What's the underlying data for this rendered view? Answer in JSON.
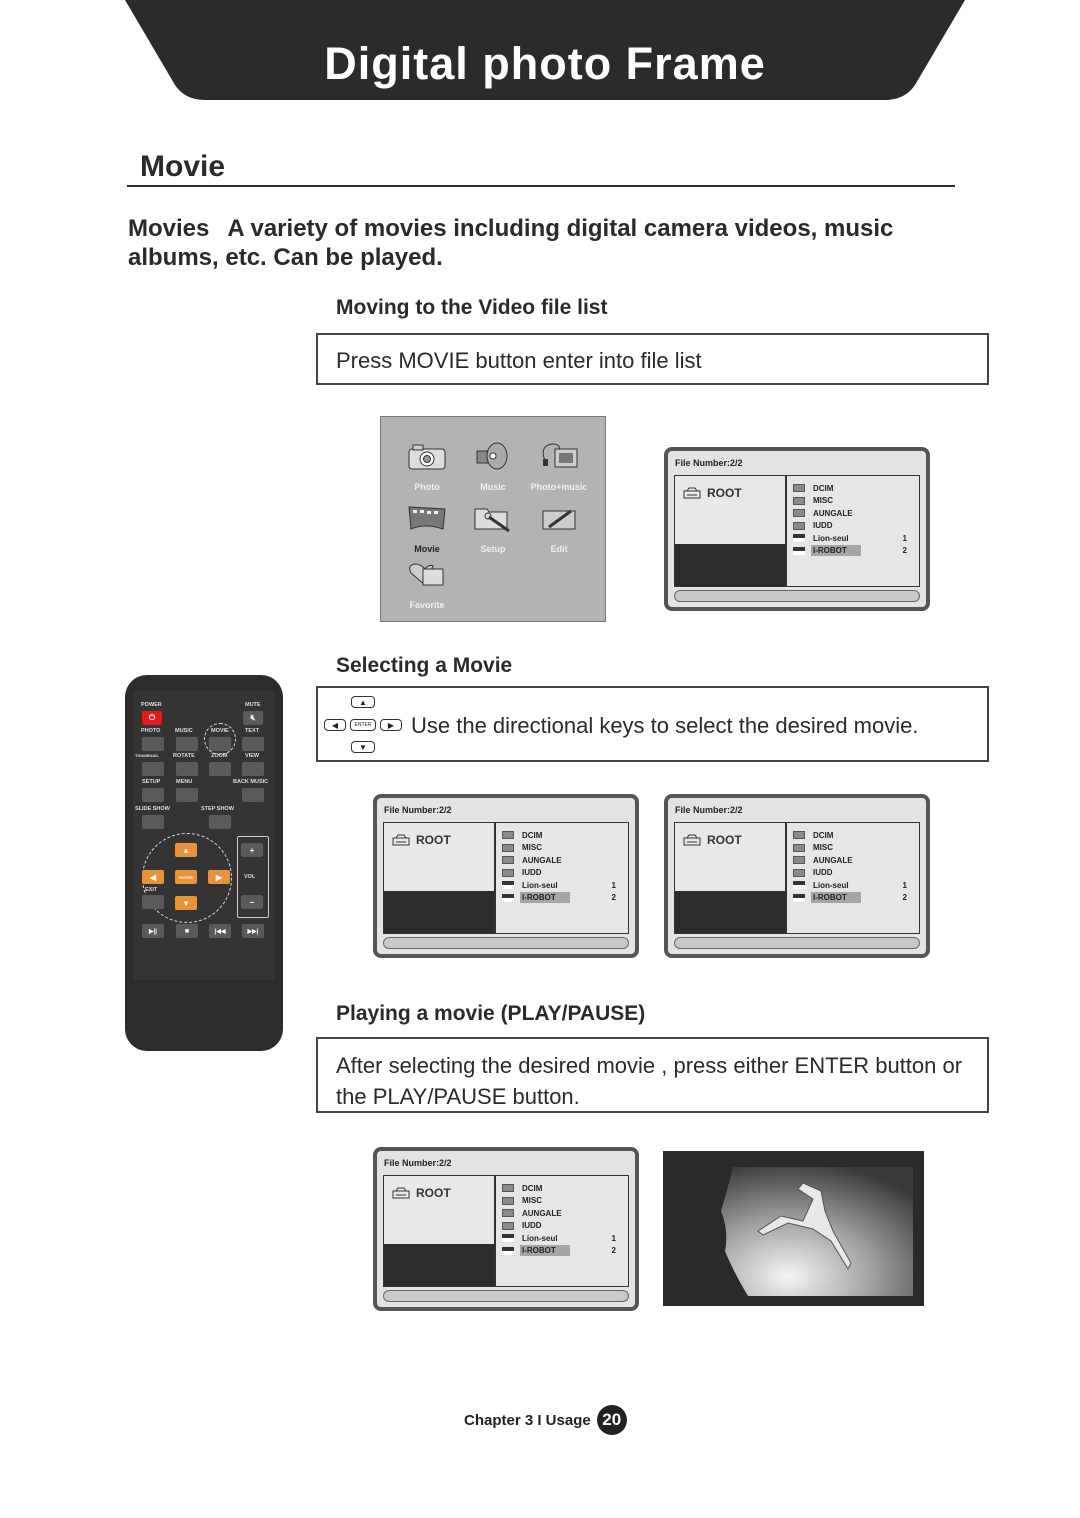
{
  "header": {
    "title": "Digital photo Frame"
  },
  "section": {
    "title": "Movie",
    "intro_lead": "Movies",
    "intro_text": "A variety of movies including digital camera videos, music albums, etc. Can be played."
  },
  "steps": [
    {
      "heading": "Moving to the Video file list",
      "instruction": "Press MOVIE button enter into  file list"
    },
    {
      "heading": "Selecting a Movie",
      "instruction": "Use the directional keys to select the desired movie."
    },
    {
      "heading": "Playing a movie (PLAY/PAUSE)",
      "instruction": "After selecting the desired movie , press either ENTER button or the PLAY/PAUSE button."
    }
  ],
  "main_menu": {
    "items": [
      {
        "label": "Photo",
        "icon": "camera-icon",
        "active": false
      },
      {
        "label": "Music",
        "icon": "speaker-icon",
        "active": false
      },
      {
        "label": "Photo+music",
        "icon": "photo-music-icon",
        "active": false
      },
      {
        "label": "Movie",
        "icon": "film-icon",
        "active": true
      },
      {
        "label": "Setup",
        "icon": "folder-wrench-icon",
        "active": false
      },
      {
        "label": "Edit",
        "icon": "edit-icon",
        "active": false
      },
      {
        "label": "Favorite",
        "icon": "heart-photo-icon",
        "active": false
      }
    ]
  },
  "file_list": {
    "header": "File Number:2/2",
    "root_label": "ROOT",
    "entries": [
      {
        "name": "DCIM",
        "type": "folder",
        "num": ""
      },
      {
        "name": "MISC",
        "type": "folder",
        "num": ""
      },
      {
        "name": "AUNGALE",
        "type": "folder",
        "num": ""
      },
      {
        "name": "IUDD",
        "type": "folder",
        "num": ""
      },
      {
        "name": "Lion-seul",
        "type": "movie",
        "num": "1"
      },
      {
        "name": "I-ROBOT",
        "type": "movie",
        "num": "2",
        "selected": true
      }
    ]
  },
  "dir_keys": {
    "enter": "ENTER",
    "up": "▲",
    "down": "▼",
    "left": "◀",
    "right": "▶"
  },
  "remote": {
    "labels": {
      "power": "POWER",
      "mute": "MUTE",
      "photo": "PHOTO",
      "music": "MUSIC",
      "movie": "MOVIE",
      "text": "TEXT",
      "thumbnail": "THUMBNAIL",
      "rotate": "ROTATE",
      "zoom": "ZOOM",
      "view": "VIEW",
      "setup": "SETUP",
      "menu": "MENU",
      "back_music": "BACK MUSIC",
      "slide_show": "SLIDE SHOW",
      "step_show": "STEP SHOW",
      "enter": "ENTER",
      "exit": "EXIT",
      "vol": "VOL",
      "plus": "+",
      "minus": "−"
    },
    "transport": [
      "▶||",
      "■",
      "|◀◀",
      "▶▶|"
    ]
  },
  "footer": {
    "chapter": "Chapter 3 I Usage",
    "page": "20"
  }
}
